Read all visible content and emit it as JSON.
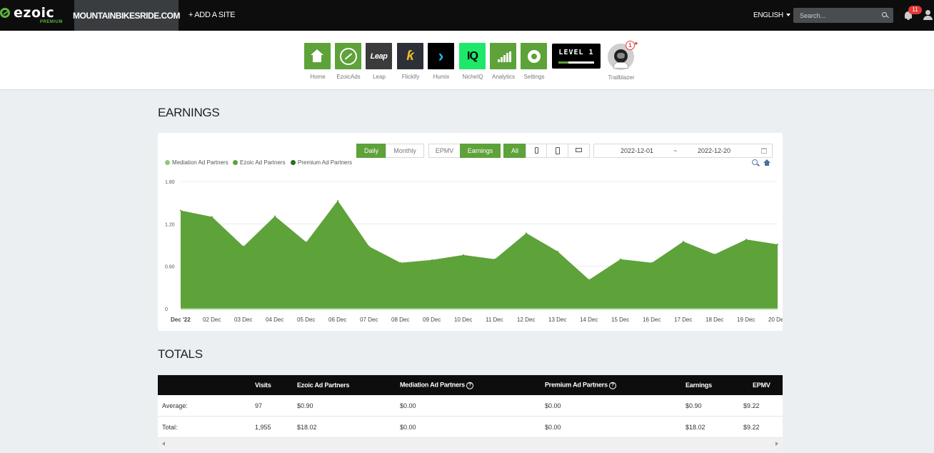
{
  "topbar": {
    "logo_text": "ezoic",
    "logo_sub": "PREMIUM",
    "site": "MOUNTAINBIKESRIDE.COM",
    "add_site": "+ ADD A SITE",
    "language": "ENGLISH",
    "search_placeholder": "Search...",
    "notification_count": "11"
  },
  "apps": [
    {
      "label": "Home",
      "icon": "home-icon"
    },
    {
      "label": "EzoicAds",
      "icon": "ezoicads-icon"
    },
    {
      "label": "Leap",
      "icon": "leap-icon",
      "tile_text": "Leap"
    },
    {
      "label": "Flickify",
      "icon": "flickify-icon",
      "tile_text": "ƙ"
    },
    {
      "label": "Humix",
      "icon": "humix-icon",
      "tile_text": "›"
    },
    {
      "label": "NicheIQ",
      "icon": "nicheiq-icon",
      "tile_text": "IQ"
    },
    {
      "label": "Analytics",
      "icon": "analytics-icon"
    },
    {
      "label": "Settings",
      "icon": "gear-icon"
    }
  ],
  "level": {
    "text": "LEVEL 1",
    "progress": 0.28
  },
  "trailblazer": {
    "label": "Trailblazer",
    "badge": "1"
  },
  "earnings": {
    "heading": "EARNINGS",
    "period_buttons": [
      "Daily",
      "Monthly"
    ],
    "metric_buttons": [
      "EPMV",
      "Earnings"
    ],
    "device_all": "All",
    "date_start": "2022-12-01",
    "date_sep": "~",
    "date_end": "2022-12-20",
    "legend": [
      {
        "name": "Mediation Ad Partners",
        "color": "#8fc97a"
      },
      {
        "name": "Ezoic Ad Partners",
        "color": "#5ea23a"
      },
      {
        "name": "Premium Ad Partners",
        "color": "#2e6b22"
      }
    ]
  },
  "chart_data": {
    "type": "area",
    "x": [
      "Dec '22",
      "02 Dec",
      "03 Dec",
      "04 Dec",
      "05 Dec",
      "06 Dec",
      "07 Dec",
      "08 Dec",
      "09 Dec",
      "10 Dec",
      "11 Dec",
      "12 Dec",
      "13 Dec",
      "14 Dec",
      "15 Dec",
      "16 Dec",
      "17 Dec",
      "18 Dec",
      "19 Dec",
      "20 Dec"
    ],
    "series": [
      {
        "name": "Ezoic Ad Partners",
        "values": [
          1.39,
          1.3,
          0.88,
          1.31,
          0.94,
          1.53,
          0.88,
          0.65,
          0.69,
          0.76,
          0.7,
          1.07,
          0.81,
          0.41,
          0.7,
          0.65,
          0.95,
          0.77,
          0.98,
          0.91
        ]
      }
    ],
    "ylim": [
      0,
      1.8
    ],
    "yticks": [
      "0",
      "0.60",
      "1.20",
      "1.80"
    ],
    "grid": true,
    "legend_position": "top-left"
  },
  "totals": {
    "heading": "TOTALS",
    "columns": [
      "",
      "Visits",
      "Ezoic Ad Partners",
      "Mediation Ad Partners",
      "Premium Ad Partners",
      "Earnings",
      "EPMV"
    ],
    "help_glyph": "?",
    "rows": [
      [
        "Average:",
        "97",
        "$0.90",
        "$0.00",
        "$0.00",
        "$0.90",
        "$9.22"
      ],
      [
        "Total:",
        "1,955",
        "$18.02",
        "$0.00",
        "$0.00",
        "$18.02",
        "$9.22"
      ]
    ]
  }
}
